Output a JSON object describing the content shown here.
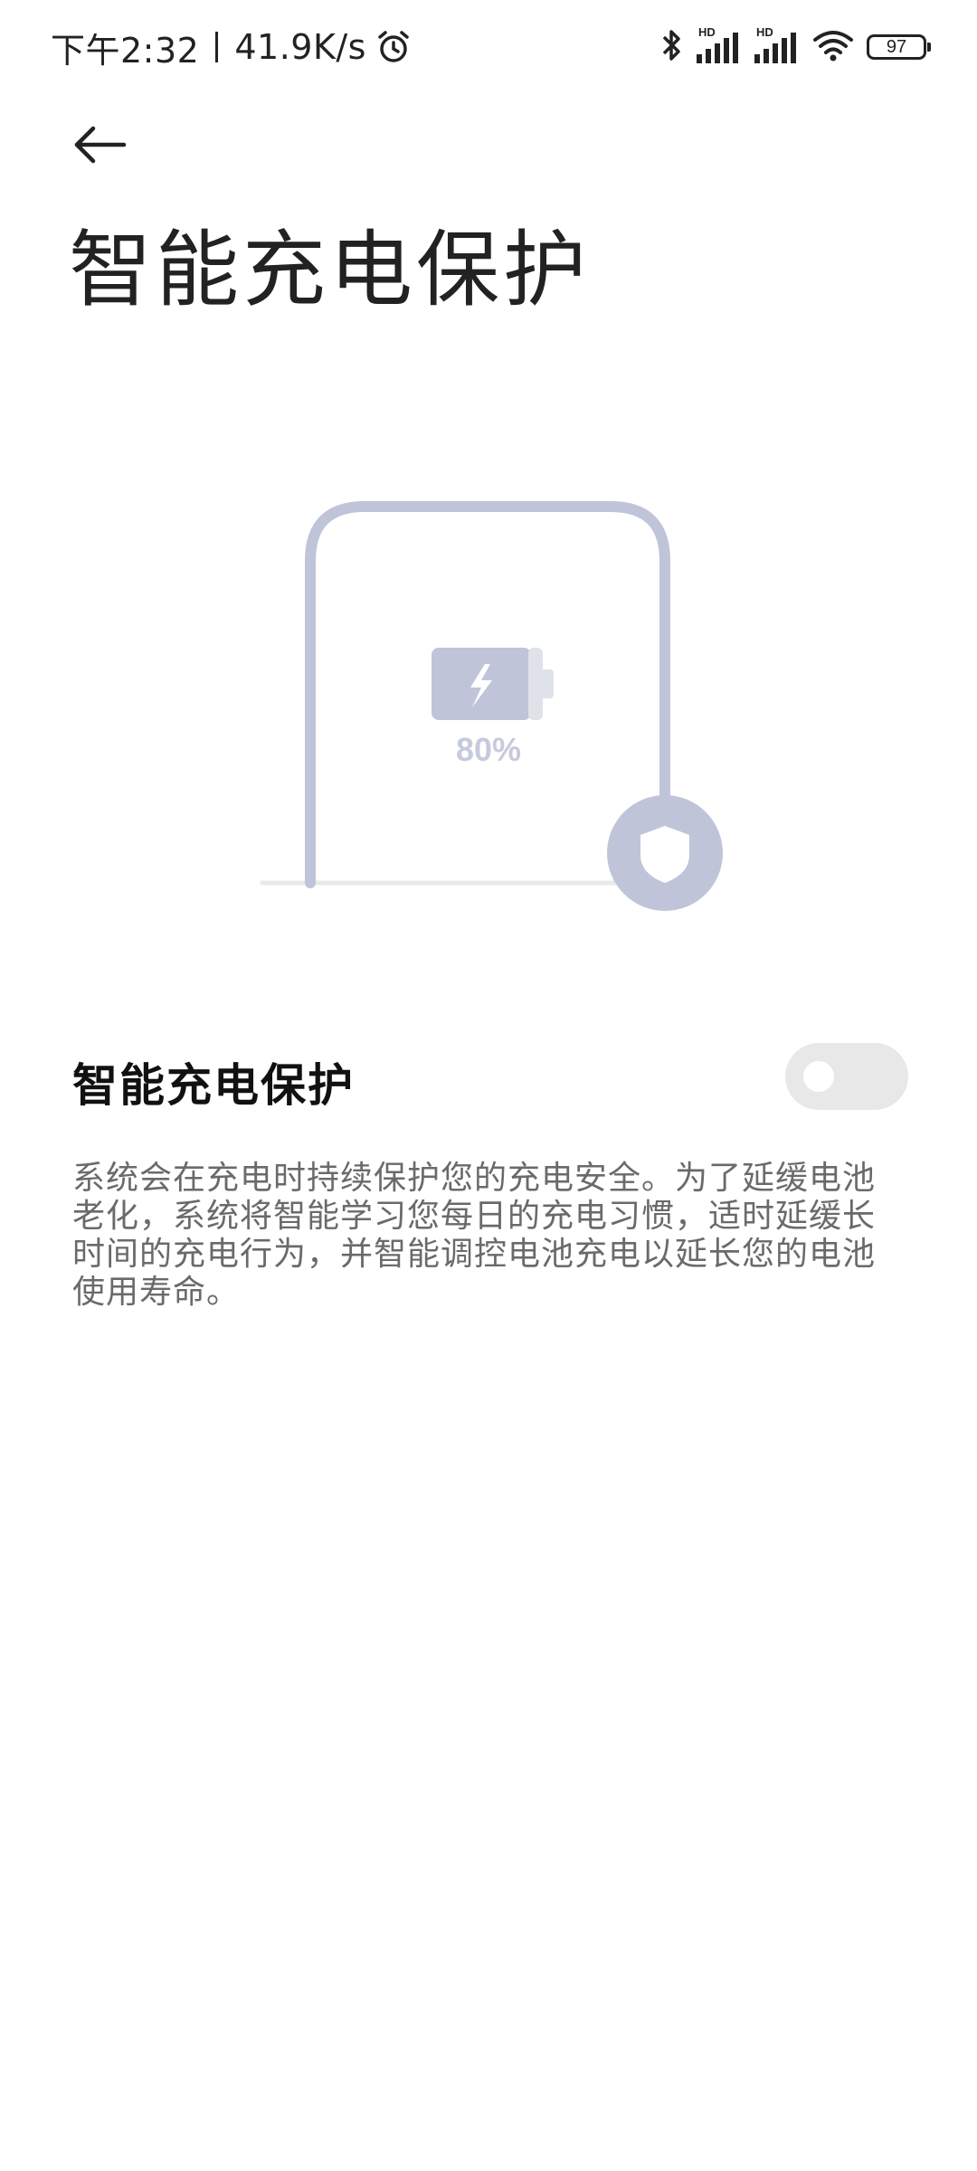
{
  "status_bar": {
    "time": "下午2:32",
    "speed": "41.9K/s",
    "signal1_label": "HD",
    "signal2_label": "HD",
    "battery": "97"
  },
  "header": {
    "title": "智能充电保护"
  },
  "illustration": {
    "battery_percent": "80%",
    "accent_color": "#bfc4d9"
  },
  "setting": {
    "label": "智能充电保护",
    "toggle_on": false
  },
  "description": "系统会在充电时持续保护您的充电安全。为了延缓电池老化，系统将智能学习您每日的充电习惯，适时延缓长时间的充电行为，并智能调控电池充电以延长您的电池使用寿命。"
}
